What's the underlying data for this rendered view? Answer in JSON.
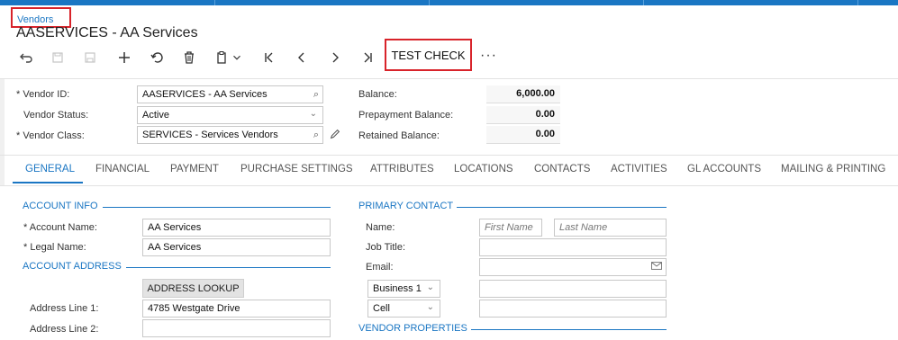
{
  "breadcrumb": {
    "label": "Vendors"
  },
  "title": "AASERVICES - AA Services",
  "toolbar": {
    "buttons": [
      "back-icon",
      "save-and-close-icon",
      "save-icon",
      "add-icon",
      "undo-icon",
      "delete-icon",
      "copy-paste-icon",
      "first-icon",
      "previous-icon",
      "next-icon",
      "last-icon"
    ],
    "test_check_label": "TEST CHECK",
    "more_label": "···"
  },
  "summary": {
    "vendor_id_label": "Vendor ID:",
    "vendor_id_value": "AASERVICES - AA Services",
    "vendor_status_label": "Vendor Status:",
    "vendor_status_value": "Active",
    "vendor_class_label": "Vendor Class:",
    "vendor_class_value": "SERVICES - Services Vendors",
    "balance_label": "Balance:",
    "balance_value": "6,000.00",
    "prepayment_label": "Prepayment Balance:",
    "prepayment_value": "0.00",
    "retained_label": "Retained Balance:",
    "retained_value": "0.00"
  },
  "tabs": [
    "GENERAL",
    "FINANCIAL",
    "PAYMENT",
    "PURCHASE SETTINGS",
    "ATTRIBUTES",
    "LOCATIONS",
    "CONTACTS",
    "ACTIVITIES",
    "GL ACCOUNTS",
    "MAILING & PRINTING"
  ],
  "active_tab": "GENERAL",
  "account_info": {
    "heading": "ACCOUNT INFO",
    "account_name_label": "Account Name:",
    "account_name_value": "AA Services",
    "legal_name_label": "Legal Name:",
    "legal_name_value": "AA Services"
  },
  "account_address": {
    "heading": "ACCOUNT ADDRESS",
    "lookup_label": "ADDRESS LOOKUP",
    "line1_label": "Address Line 1:",
    "line1_value": "4785 Westgate Drive",
    "line2_label": "Address Line 2:",
    "line2_value": ""
  },
  "primary_contact": {
    "heading": "PRIMARY CONTACT",
    "name_label": "Name:",
    "first_name_placeholder": "First Name",
    "last_name_placeholder": "Last Name",
    "job_title_label": "Job Title:",
    "email_label": "Email:",
    "phone1_type": "Business 1",
    "phone2_type": "Cell"
  },
  "vendor_properties": {
    "heading": "VENDOR PROPERTIES"
  },
  "colors": {
    "accent": "#1a76c3",
    "highlight": "#d8232a"
  }
}
